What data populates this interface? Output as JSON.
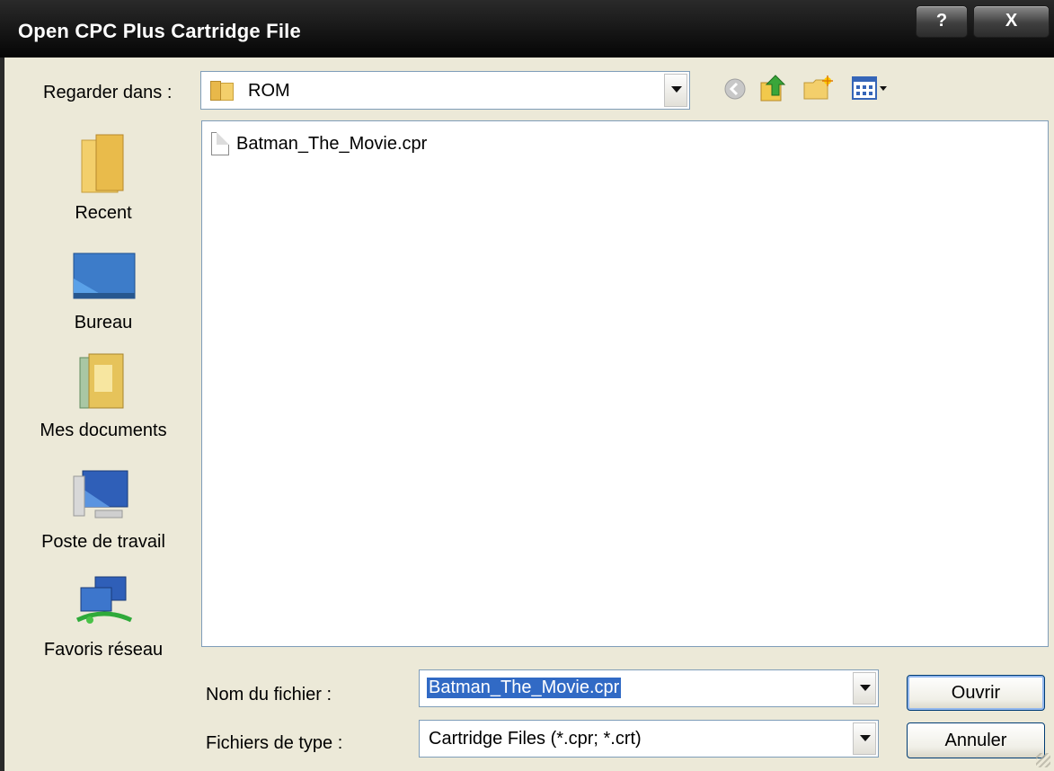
{
  "window": {
    "title": "Open CPC Plus Cartridge File",
    "help_label": "?",
    "close_label": "X"
  },
  "lookin": {
    "label": "Regarder dans :",
    "value": "ROM"
  },
  "toolbar": {
    "icons": [
      "back-icon",
      "up-folder-icon",
      "new-folder-icon",
      "view-menu-icon"
    ]
  },
  "places": [
    {
      "label": "Recent",
      "icon": "recent-folder-icon"
    },
    {
      "label": "Bureau",
      "icon": "desktop-icon"
    },
    {
      "label": "Mes documents",
      "icon": "my-documents-icon"
    },
    {
      "label": "Poste de travail",
      "icon": "my-computer-icon"
    },
    {
      "label": "Favoris réseau",
      "icon": "network-places-icon"
    }
  ],
  "files": [
    {
      "name": "Batman_The_Movie.cpr"
    }
  ],
  "filename": {
    "label": "Nom du fichier :",
    "value": "Batman_The_Movie.cpr"
  },
  "filetype": {
    "label": "Fichiers de type :",
    "value": "Cartridge Files (*.cpr; *.crt)"
  },
  "buttons": {
    "open": "Ouvrir",
    "cancel": "Annuler"
  },
  "colors": {
    "dialog_bg": "#ece9d8",
    "selection": "#316ac5",
    "titlebar": "#0a0a0a"
  }
}
